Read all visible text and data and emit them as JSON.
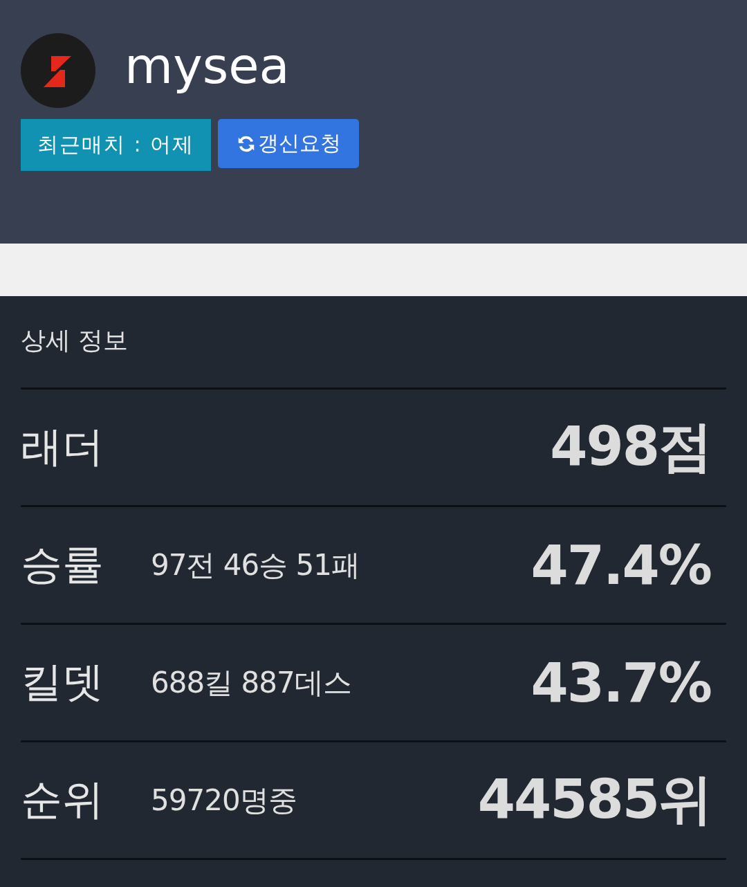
{
  "profile": {
    "name": "mysea",
    "last_match": "최근매치 : 어제",
    "refresh_button": "갱신요청"
  },
  "details": {
    "title": "상세 정보",
    "rows": [
      {
        "label": "래더",
        "detail": "",
        "value": "498점"
      },
      {
        "label": "승률",
        "detail": "97전 46승 51패",
        "value": "47.4%"
      },
      {
        "label": "킬뎃",
        "detail": "688킬 887데스",
        "value": "43.7%"
      },
      {
        "label": "순위",
        "detail": "59720명중",
        "value": "44585위"
      }
    ]
  }
}
